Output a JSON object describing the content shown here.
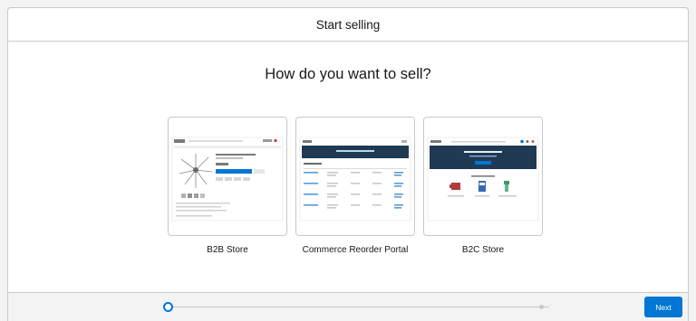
{
  "header": {
    "title": "Start selling"
  },
  "question": "How do you want to sell?",
  "options": [
    {
      "label": "B2B Store",
      "thumbnail_icon": "b2b-store-preview"
    },
    {
      "label": "Commerce Reorder Portal",
      "thumbnail_icon": "reorder-portal-preview"
    },
    {
      "label": "B2C Store",
      "thumbnail_icon": "b2c-store-preview"
    }
  ],
  "footer": {
    "next_label": "Next",
    "progress_current_step": 1,
    "progress_total_steps": 2,
    "accent_color": "#0176d3"
  }
}
